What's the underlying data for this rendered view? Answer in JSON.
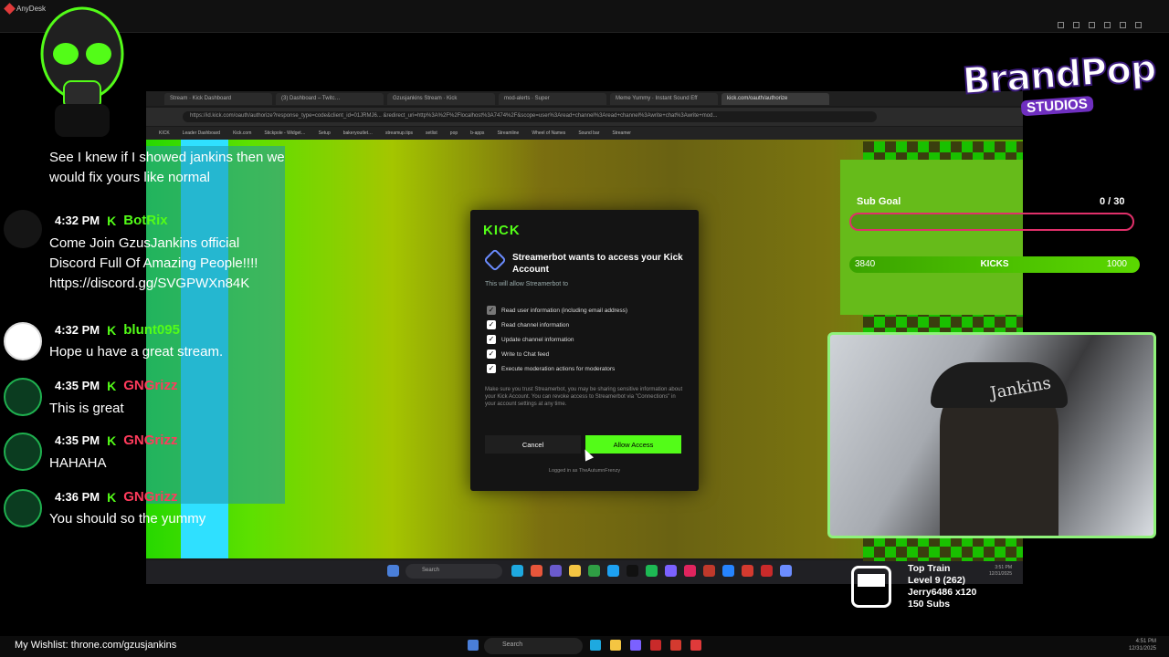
{
  "app": {
    "title": "AnyDesk"
  },
  "browser": {
    "tabs": [
      {
        "label": "Stream · Kick Dashboard",
        "active": false
      },
      {
        "label": "(3) Dashboard – Twitc…",
        "active": false
      },
      {
        "label": "Gzusjankins Stream · Kick",
        "active": false
      },
      {
        "label": "mod-alerts · Super",
        "active": false
      },
      {
        "label": "Meme Yummy · Instant Sound Eff",
        "active": false
      },
      {
        "label": "kick.com/oauth/authorize",
        "active": true
      }
    ],
    "url": "https://id.kick.com/oauth/authorize?response_type=code&client_id=01JRMJ6... &redirect_uri=http%3A%2F%2Flocalhost%3A7474%2F&scope=user%3Aread+channel%3Aread+channel%3Awrite+chat%3Awrite+mod...",
    "bookmarks": [
      "KICK",
      "Leader Dashboard",
      "Kick.com",
      "Stickpole - Widget…",
      "Setup",
      "bakeryoutlet…",
      "streamup.tips",
      "setlist",
      "pop",
      "b-apps",
      "Streamline",
      "Wheel of Names",
      "Sound bar",
      "Streamer"
    ]
  },
  "dialog": {
    "logo": "KICK",
    "title": "Streamerbot wants to access your Kick Account",
    "subtitle": "This will allow Streamerbot to",
    "permissions": [
      {
        "label": "Read user information (including email address)",
        "checked": true,
        "locked": true
      },
      {
        "label": "Read channel information",
        "checked": true,
        "locked": false
      },
      {
        "label": "Update channel information",
        "checked": true,
        "locked": false
      },
      {
        "label": "Write to Chat feed",
        "checked": true,
        "locked": false
      },
      {
        "label": "Execute moderation actions for moderators",
        "checked": true,
        "locked": false
      }
    ],
    "notice": "Make sure you trust Streamerbot, you may be sharing sensitive information about your Kick Account. You can revoke access to Streamerbot via \"Connections\" in your account settings at any time.",
    "cancel_label": "Cancel",
    "allow_label": "Allow Access",
    "logged_in": "Logged in as TheAutumnFrenzy"
  },
  "screen_taskbar": {
    "search_placeholder": "Search",
    "clock": "3:51 PM\n12/31/2025"
  },
  "chat": {
    "messages": [
      {
        "time": "",
        "user": "",
        "user_color": "#ffffff",
        "text": "See I knew if I showed jankins then we would fix yours like normal",
        "avatar": "green"
      },
      {
        "time": "4:32 PM",
        "user": "BotRix",
        "user_color": "#53fc18",
        "text": "Come Join GzusJankins official Discord Full Of Amazing People!!!! https://discord.gg/SVGPWXn84K",
        "avatar": "bot"
      },
      {
        "time": "4:32 PM",
        "user": "blunt095",
        "user_color": "#53fc18",
        "text": "Hope u have a great stream.",
        "avatar": "blunt"
      },
      {
        "time": "4:35 PM",
        "user": "GNGrizz",
        "user_color": "#ff3b5c",
        "text": "This is great",
        "avatar": "green"
      },
      {
        "time": "4:35 PM",
        "user": "GNGrizz",
        "user_color": "#ff3b5c",
        "text": "HAHAHA",
        "avatar": "green"
      },
      {
        "time": "4:36 PM",
        "user": "GNGrizz",
        "user_color": "#ff3b5c",
        "text": "You should so the yummy",
        "avatar": "green"
      }
    ]
  },
  "overlay": {
    "brand_name": "BrandPop",
    "brand_sub": "STUDIOS",
    "sub_goal_label": "Sub Goal",
    "sub_goal_count": "0 / 30",
    "sub_goal_progress": 0,
    "kicks_start": "3840",
    "kicks_label": "KICKS",
    "kicks_end": "1000",
    "cam_cap_text": "Jankins",
    "top_train": {
      "title": "Top Train",
      "level": "Level 9 (262)",
      "user": "Jerry6486 x120",
      "subs": "150 Subs"
    }
  },
  "bottombar": {
    "wishlist": "My Wishlist: throne.com/gzusjankins",
    "search_placeholder": "Search",
    "clock": "4:51 PM\n12/31/2025"
  },
  "colors": {
    "kick_green": "#53fc18",
    "dialog_bg": "#141414",
    "goal_bar_border": "#e0306a"
  }
}
